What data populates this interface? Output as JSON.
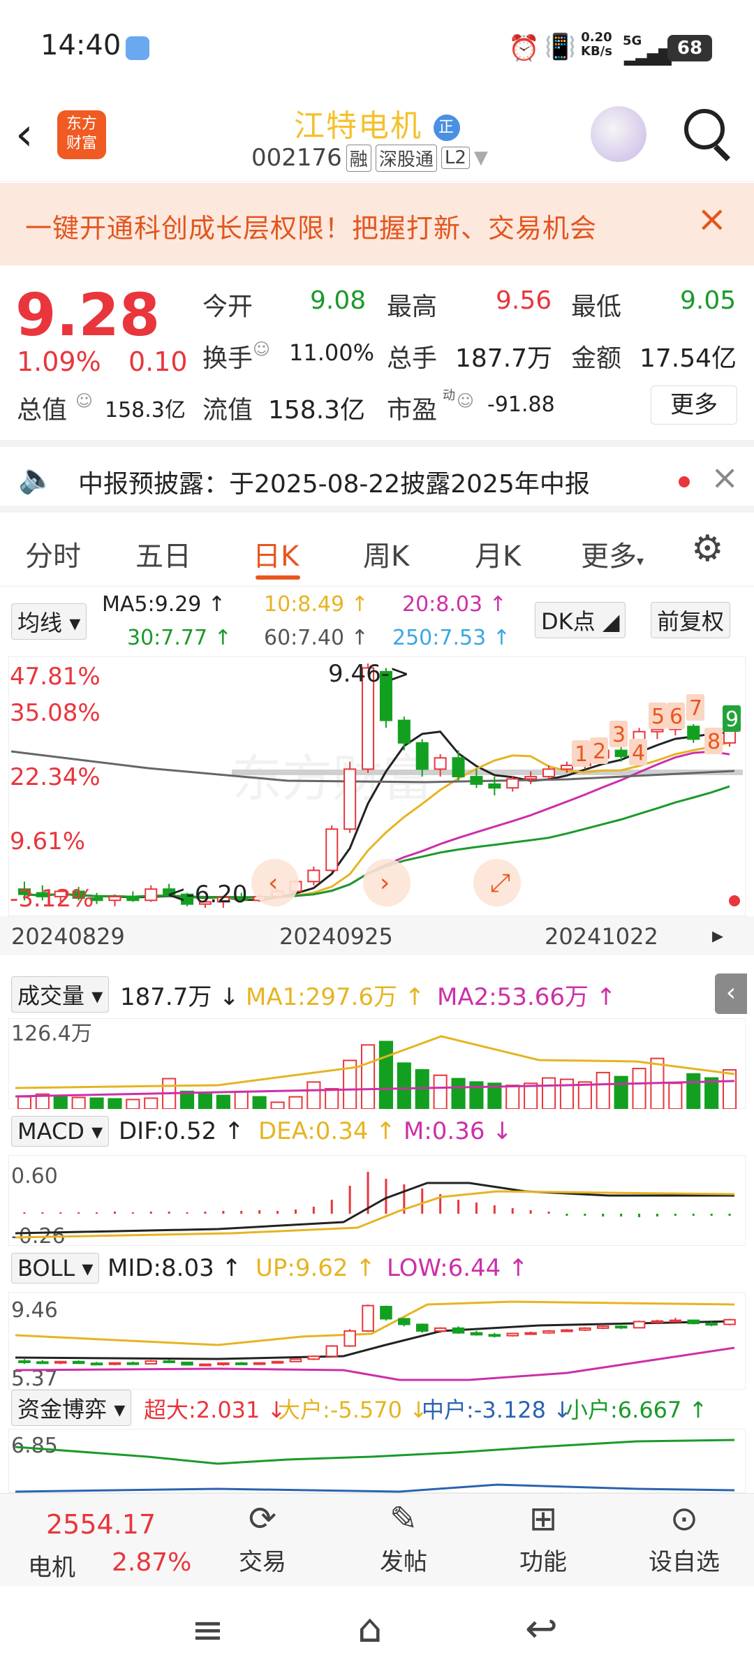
{
  "status_bar": {
    "time": "14:40",
    "net_speed_value": "0.20",
    "net_speed_unit": "KB/s",
    "network": "5G",
    "battery": "68"
  },
  "header": {
    "stock_name": "江特电机",
    "badge": "正",
    "code": "002176",
    "tag_margin": "融",
    "tag_connect": "深股通",
    "tag_level": "L2",
    "logo_line1": "东方",
    "logo_line2": "财富"
  },
  "banner": {
    "text": "一键开通科创成长层权限！把握打新、交易机会"
  },
  "quote": {
    "price": "9.28",
    "change_pct": "1.09%",
    "change": "0.10",
    "open_label": "今开",
    "open": "9.08",
    "high_label": "最高",
    "high": "9.56",
    "low_label": "最低",
    "low": "9.05",
    "turnover_label": "换手",
    "turnover": "11.00%",
    "volume_label": "总手",
    "volume": "187.7万",
    "amount_label": "金额",
    "amount": "17.54亿",
    "mktcap_label": "总值",
    "mktcap": "158.3亿",
    "float_label": "流值",
    "float": "158.3亿",
    "pe_label": "市盈",
    "pe_sup": "动",
    "pe": "-91.88",
    "more_label": "更多"
  },
  "notice": {
    "text": "中报预披露：于2025-08-22披露2025年中报"
  },
  "tabs": [
    "分时",
    "五日",
    "日K",
    "周K",
    "月K",
    "更多"
  ],
  "ma_bar": {
    "selector": "均线",
    "ma5": "MA5:9.29 ↑",
    "ma10": "10:8.49 ↑",
    "ma20": "20:8.03 ↑",
    "ma30": "30:7.77 ↑",
    "ma60": "60:7.40 ↑",
    "ma250": "250:7.53 ↑",
    "dk_button": "DK点",
    "adjust_button": "前复权"
  },
  "kchart": {
    "pct_labels": [
      "47.81%",
      "35.08%",
      "22.34%",
      "9.61%",
      "-3.12%"
    ],
    "high_marker": "9.46->",
    "low_marker": "<-6.20",
    "dates": [
      "20240829",
      "20240925",
      "20241022"
    ],
    "dk_marks": [
      "1",
      "2",
      "3",
      "4",
      "5",
      "6",
      "7",
      "8",
      "9"
    ],
    "watermark": "东方财富"
  },
  "volume": {
    "selector": "成交量",
    "value": "187.7万 ↓",
    "ma1": "MA1:297.6万 ↑",
    "ma2": "MA2:53.66万 ↑",
    "axis_max": "126.4万"
  },
  "macd": {
    "selector": "MACD",
    "dif": "DIF:0.52 ↑",
    "dea": "DEA:0.34 ↑",
    "m": "M:0.36 ↓",
    "axis_max": "0.60",
    "axis_min": "-0.26"
  },
  "boll": {
    "selector": "BOLL",
    "mid": "MID:8.03 ↑",
    "up": "UP:9.62 ↑",
    "low": "LOW:6.44 ↑",
    "axis_max": "9.46",
    "axis_min": "5.37"
  },
  "fund": {
    "selector": "资金博弈",
    "super": "超大:2.031 ↓",
    "big": "大户:-5.570 ↓",
    "mid": "中户:-3.128 ↓",
    "small": "小户:6.667 ↑",
    "axis_max": "6.85"
  },
  "bottom_nav": {
    "index_value": "2554.17",
    "index_name": "电机",
    "index_pct": "2.87%",
    "trade": "交易",
    "post": "发帖",
    "function": "功能",
    "watch": "设自选"
  },
  "chart_data": [
    {
      "type": "candlestick",
      "title": "日K",
      "dates": [
        "20240829",
        "20240925",
        "20241022"
      ],
      "ohlc_note": "price scale 6.20-9.46",
      "candles": [
        {
          "o": 6.45,
          "h": 6.55,
          "l": 6.3,
          "c": 6.38
        },
        {
          "o": 6.4,
          "h": 6.5,
          "l": 6.3,
          "c": 6.35
        },
        {
          "o": 6.35,
          "h": 6.45,
          "l": 6.28,
          "c": 6.42
        },
        {
          "o": 6.42,
          "h": 6.48,
          "l": 6.3,
          "c": 6.33
        },
        {
          "o": 6.33,
          "h": 6.4,
          "l": 6.25,
          "c": 6.3
        },
        {
          "o": 6.3,
          "h": 6.38,
          "l": 6.22,
          "c": 6.35
        },
        {
          "o": 6.35,
          "h": 6.42,
          "l": 6.28,
          "c": 6.3
        },
        {
          "o": 6.3,
          "h": 6.5,
          "l": 6.28,
          "c": 6.45
        },
        {
          "o": 6.45,
          "h": 6.52,
          "l": 6.35,
          "c": 6.38
        },
        {
          "o": 6.38,
          "h": 6.4,
          "l": 6.22,
          "c": 6.25
        },
        {
          "o": 6.25,
          "h": 6.3,
          "l": 6.2,
          "c": 6.28
        },
        {
          "o": 6.28,
          "h": 6.36,
          "l": 6.2,
          "c": 6.34
        },
        {
          "o": 6.34,
          "h": 6.4,
          "l": 6.28,
          "c": 6.3
        },
        {
          "o": 6.3,
          "h": 6.38,
          "l": 6.28,
          "c": 6.35
        },
        {
          "o": 6.35,
          "h": 6.45,
          "l": 6.32,
          "c": 6.42
        },
        {
          "o": 6.42,
          "h": 6.58,
          "l": 6.4,
          "c": 6.55
        },
        {
          "o": 6.55,
          "h": 6.75,
          "l": 6.5,
          "c": 6.7
        },
        {
          "o": 6.7,
          "h": 7.3,
          "l": 6.68,
          "c": 7.25
        },
        {
          "o": 7.25,
          "h": 8.15,
          "l": 7.2,
          "c": 8.05
        },
        {
          "o": 8.05,
          "h": 9.46,
          "l": 8.0,
          "c": 9.4
        },
        {
          "o": 9.35,
          "h": 9.4,
          "l": 8.6,
          "c": 8.7
        },
        {
          "o": 8.7,
          "h": 8.75,
          "l": 8.3,
          "c": 8.4
        },
        {
          "o": 8.4,
          "h": 8.45,
          "l": 7.95,
          "c": 8.05
        },
        {
          "o": 8.05,
          "h": 8.25,
          "l": 7.95,
          "c": 8.2
        },
        {
          "o": 8.2,
          "h": 8.3,
          "l": 7.9,
          "c": 7.95
        },
        {
          "o": 7.95,
          "h": 8.05,
          "l": 7.8,
          "c": 7.85
        },
        {
          "o": 7.85,
          "h": 7.95,
          "l": 7.7,
          "c": 7.8
        },
        {
          "o": 7.8,
          "h": 7.95,
          "l": 7.75,
          "c": 7.92
        },
        {
          "o": 7.92,
          "h": 8.02,
          "l": 7.85,
          "c": 7.95
        },
        {
          "o": 7.95,
          "h": 8.1,
          "l": 7.9,
          "c": 8.05
        },
        {
          "o": 8.05,
          "h": 8.15,
          "l": 8.0,
          "c": 8.1
        },
        {
          "o": 8.1,
          "h": 8.25,
          "l": 8.05,
          "c": 8.2
        },
        {
          "o": 8.2,
          "h": 8.4,
          "l": 8.15,
          "c": 8.3
        },
        {
          "o": 8.3,
          "h": 8.35,
          "l": 8.15,
          "c": 8.22
        },
        {
          "o": 8.22,
          "h": 8.6,
          "l": 8.2,
          "c": 8.55
        },
        {
          "o": 8.55,
          "h": 8.65,
          "l": 8.45,
          "c": 8.58
        },
        {
          "o": 8.58,
          "h": 8.75,
          "l": 8.5,
          "c": 8.62
        },
        {
          "o": 8.62,
          "h": 8.65,
          "l": 8.4,
          "c": 8.45
        },
        {
          "o": 8.45,
          "h": 8.55,
          "l": 8.3,
          "c": 8.4
        },
        {
          "o": 8.4,
          "h": 8.7,
          "l": 8.35,
          "c": 8.65
        }
      ]
    },
    {
      "type": "bar",
      "title": "成交量",
      "ylim": [
        0,
        126.4
      ],
      "values": [
        18,
        22,
        20,
        17,
        16,
        15,
        14,
        16,
        45,
        26,
        22,
        20,
        26,
        18,
        10,
        18,
        40,
        30,
        72,
        95,
        100,
        68,
        58,
        50,
        45,
        40,
        38,
        35,
        38,
        46,
        44,
        40,
        54,
        48,
        60,
        75,
        38,
        52,
        46,
        58
      ],
      "up": [
        1,
        1,
        0,
        1,
        0,
        0,
        1,
        1,
        1,
        0,
        0,
        0,
        1,
        0,
        1,
        1,
        1,
        1,
        1,
        1,
        0,
        0,
        0,
        1,
        0,
        0,
        0,
        1,
        1,
        1,
        1,
        1,
        1,
        0,
        1,
        1,
        1,
        0,
        0,
        1
      ]
    }
  ]
}
